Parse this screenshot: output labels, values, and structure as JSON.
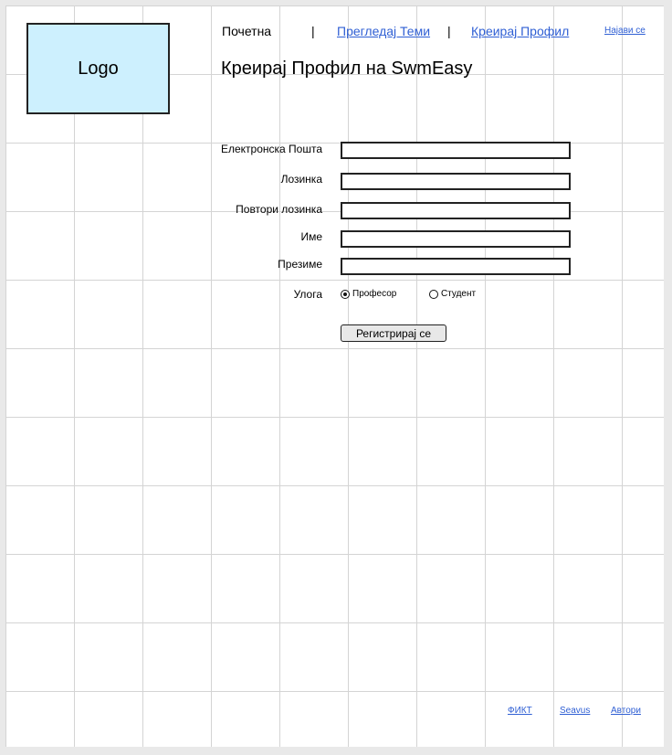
{
  "logo": {
    "text": "Logo"
  },
  "nav": {
    "home": "Почетна",
    "separator": "|",
    "browse_topics": "Прегледај Теми",
    "create_profile": "Креирај Профил",
    "login": "Најави се"
  },
  "page": {
    "title": "Креирај Профил на SwmEasy"
  },
  "form": {
    "email_label": "Електронска Пошта",
    "email_value": "",
    "password_label": "Лозинка",
    "password_value": "",
    "repeat_password_label": "Повтори лозинка",
    "repeat_password_value": "",
    "first_name_label": "Име",
    "first_name_value": "",
    "last_name_label": "Презиме",
    "last_name_value": "",
    "role_label": "Улога",
    "role_options": [
      {
        "label": "Професор",
        "selected": true
      },
      {
        "label": "Студент",
        "selected": false
      }
    ],
    "submit_label": "Регистрирај се"
  },
  "footer": {
    "links": [
      "ФИКТ",
      "Seavus",
      "Автори"
    ]
  }
}
